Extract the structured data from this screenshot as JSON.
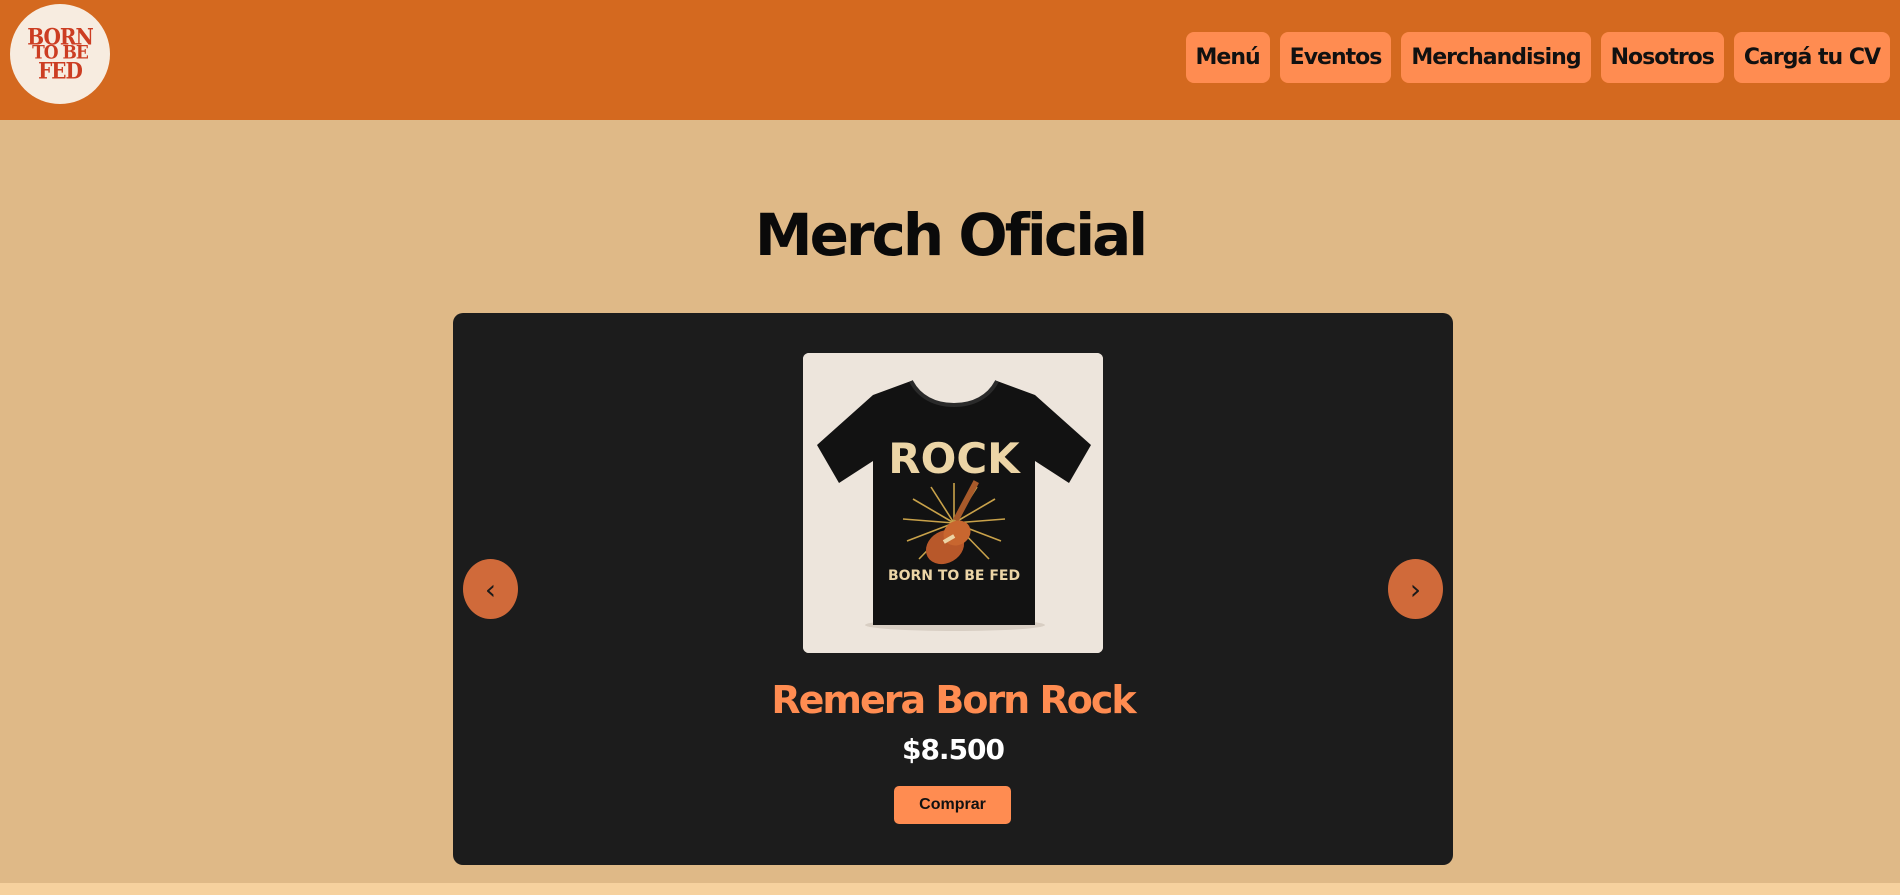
{
  "logo": {
    "lines": [
      "BORN",
      "TO BE",
      "FED"
    ]
  },
  "nav": {
    "items": [
      {
        "label": "Menú"
      },
      {
        "label": "Eventos"
      },
      {
        "label": "Merchandising"
      },
      {
        "label": "Nosotros"
      },
      {
        "label": "Cargá tu CV"
      }
    ]
  },
  "main": {
    "title": "Merch Oficial"
  },
  "carousel": {
    "prev_icon": "‹",
    "next_icon": "›",
    "product": {
      "image_text": "ROCK",
      "image_subtext": "BORN TO BE FED",
      "name": "Remera Born Rock",
      "price": "$8.500",
      "buy_label": "Comprar"
    }
  },
  "colors": {
    "header": "#d4691f",
    "background": "#dfb987",
    "accent": "#ff8c51",
    "carousel": "#1c1c1c",
    "arrow": "#d06a3a"
  }
}
